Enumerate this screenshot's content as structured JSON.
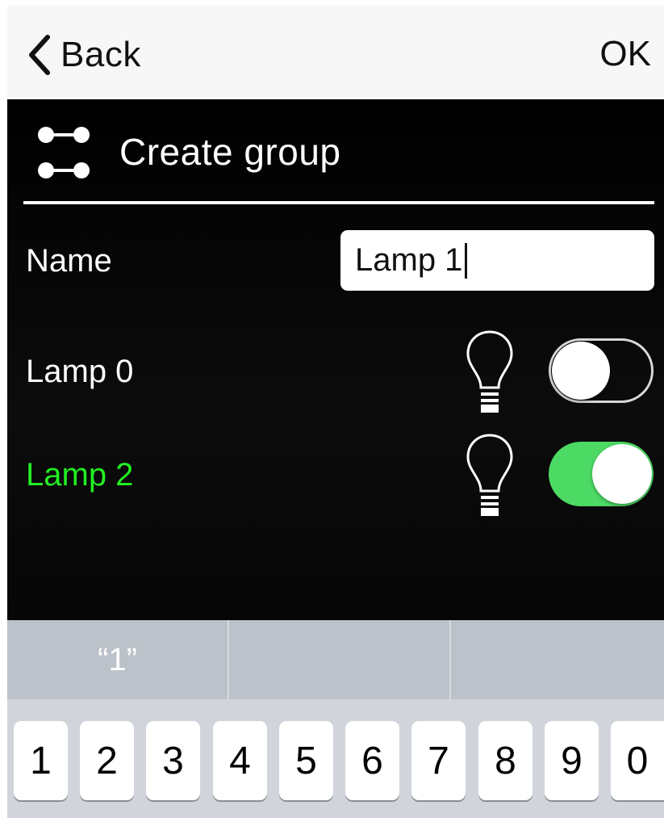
{
  "navbar": {
    "back_label": "Back",
    "ok_label": "OK"
  },
  "header": {
    "title": "Create group",
    "icon": "group-icon"
  },
  "name_field": {
    "label": "Name",
    "value": "Lamp 1"
  },
  "lamps": [
    {
      "label": "Lamp 0",
      "on": false,
      "color": "#ffffff"
    },
    {
      "label": "Lamp 2",
      "on": true,
      "color": "#22ee22"
    }
  ],
  "toggle_on_color": "#4cd964",
  "suggestions": [
    "“1”",
    "",
    ""
  ],
  "keys": [
    "1",
    "2",
    "3",
    "4",
    "5",
    "6",
    "7",
    "8",
    "9",
    "0"
  ]
}
